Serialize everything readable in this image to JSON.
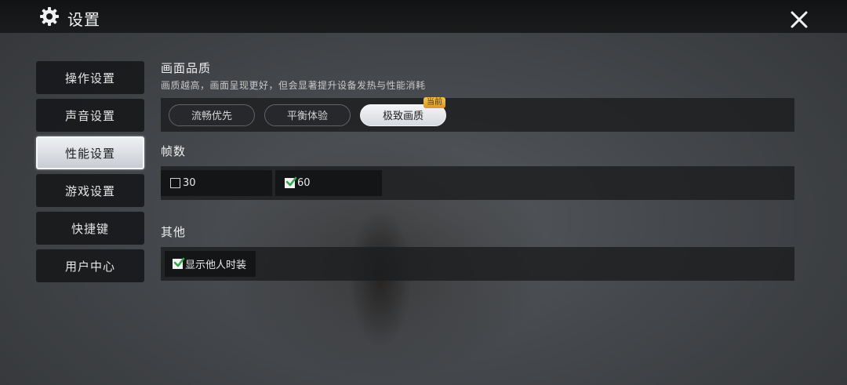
{
  "header": {
    "title": "设置",
    "icons": {
      "settings": "gear-icon",
      "close": "close-icon"
    }
  },
  "sidebar": {
    "items": [
      {
        "label": "操作设置",
        "active": false
      },
      {
        "label": "声音设置",
        "active": false
      },
      {
        "label": "性能设置",
        "active": true
      },
      {
        "label": "游戏设置",
        "active": false
      },
      {
        "label": "快捷键",
        "active": false
      },
      {
        "label": "用户中心",
        "active": false
      }
    ]
  },
  "quality": {
    "title": "画面品质",
    "description": "画质越高，画面呈现更好，但会显著提升设备发热与性能消耗",
    "options": [
      "流畅优先",
      "平衡体验",
      "极致画质"
    ],
    "selected": "极致画质",
    "badge": "当前"
  },
  "fps": {
    "title": "帧数",
    "options": [
      {
        "label": "30",
        "checked": false
      },
      {
        "label": "60",
        "checked": true
      }
    ]
  },
  "other": {
    "title": "其他",
    "options": [
      {
        "label": "显示他人时装",
        "checked": true
      }
    ]
  },
  "colors": {
    "check_green": "#2fa84f",
    "badge_gold": "#e8b03c",
    "active_tab": "#e6e9ee"
  }
}
